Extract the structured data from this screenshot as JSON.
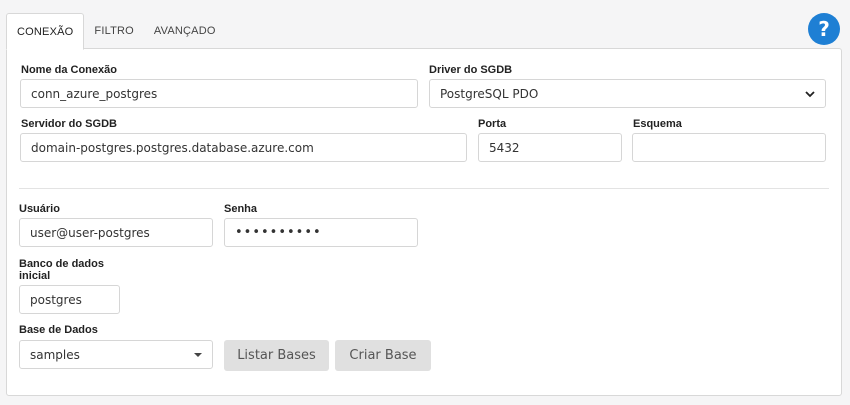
{
  "tabs": [
    {
      "label": "CONEXÃO",
      "active": true
    },
    {
      "label": "FILTRO",
      "active": false
    },
    {
      "label": "AVANÇADO",
      "active": false
    }
  ],
  "help": {
    "label": "?",
    "icon": "help-circle-icon",
    "color": "#1e7fd4"
  },
  "form": {
    "connection_name": {
      "label": "Nome da Conexão",
      "value": "conn_azure_postgres"
    },
    "driver": {
      "label": "Driver do SGDB",
      "value": "PostgreSQL PDO",
      "icon": "chevron-down-icon"
    },
    "server": {
      "label": "Servidor do SGDB",
      "value": "domain-postgres.postgres.database.azure.com"
    },
    "port": {
      "label": "Porta",
      "value": "5432"
    },
    "schema": {
      "label": "Esquema",
      "value": ""
    },
    "user": {
      "label": "Usuário",
      "value": "user@user-postgres"
    },
    "password": {
      "label": "Senha",
      "value": "••••••••••"
    },
    "initial_db": {
      "label_line1": "Banco de dados",
      "label_line2": "inicial",
      "value": "postgres"
    },
    "database": {
      "label": "Base de Dados",
      "value": "samples",
      "icon": "caret-down-icon"
    }
  },
  "buttons": {
    "list_bases": "Listar Bases",
    "create_base": "Criar Base"
  }
}
